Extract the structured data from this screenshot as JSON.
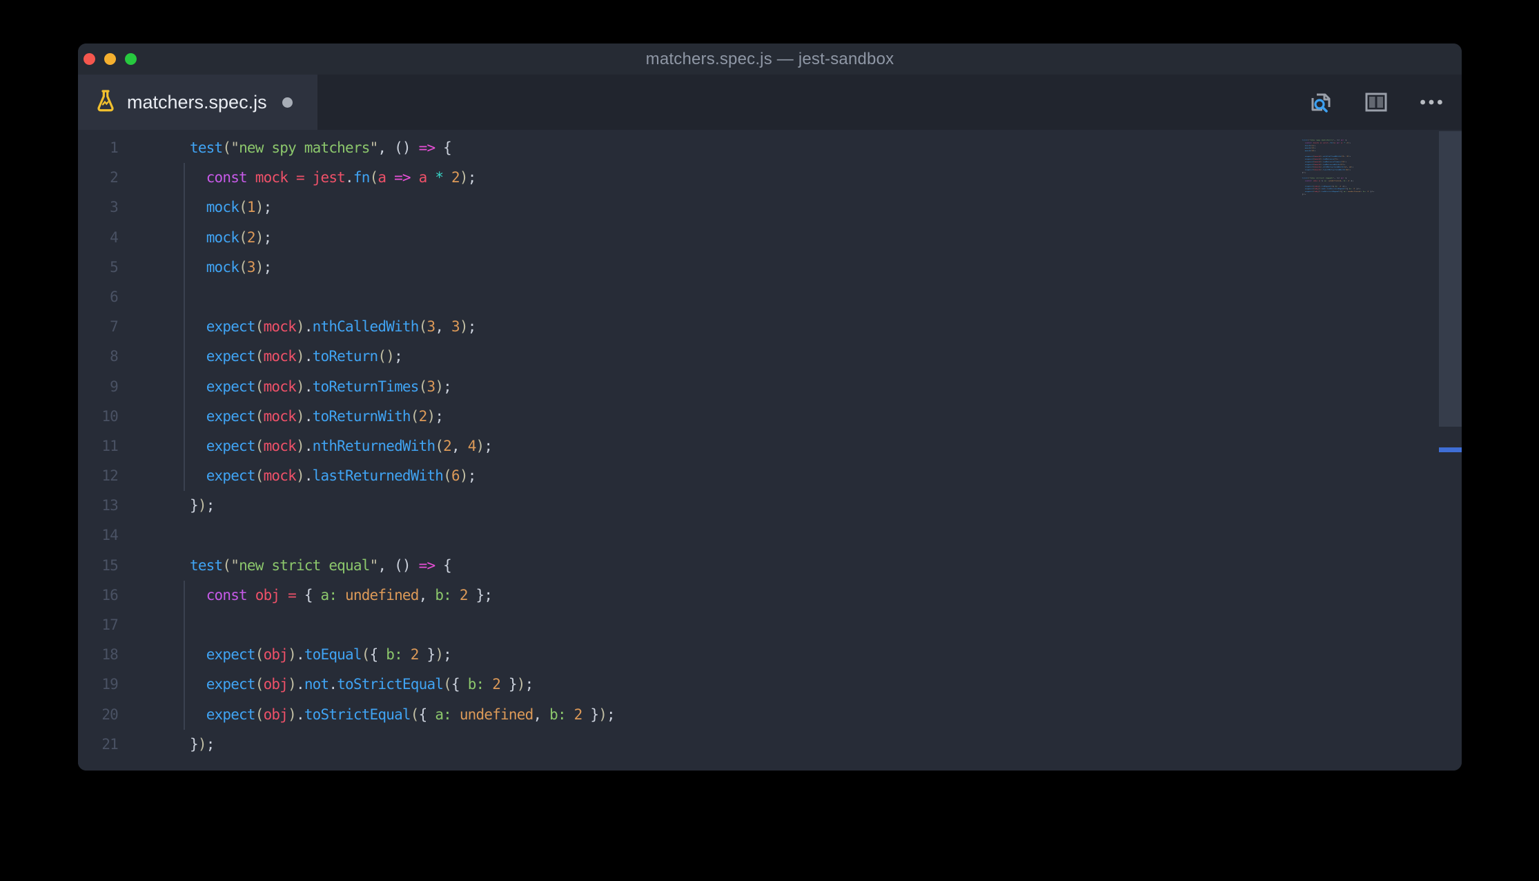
{
  "titlebar": {
    "title": "matchers.spec.js — jest-sandbox"
  },
  "traffic_lights": {
    "close": "#f5574e",
    "minimize": "#f5b02f",
    "zoom": "#27c93f"
  },
  "tab": {
    "filename": "matchers.spec.js",
    "modified": true,
    "icon": "beaker-test-icon"
  },
  "actions": {
    "search": "search-in-file-icon",
    "split": "split-editor-icon",
    "more": "more-actions-icon"
  },
  "colors": {
    "fn": "#40a4f4",
    "st": "#8cc76c",
    "kw": "#c75ae8",
    "va": "#ef5169",
    "op": "#ef5169",
    "ar": "#e84fd7",
    "nu": "#dd9a58",
    "cy": "#38d4c5",
    "pu": "#ccd2dd",
    "pa": "#c2bfa4",
    "ke": "#8cc76c",
    "ln": "#4a5264",
    "mk": "#3f6ed5",
    "editor_bg": "#272c37",
    "tabbar_bg": "#21252e",
    "tab_bg": "#2d323e",
    "titlebar_bg": "#262b34"
  },
  "code": {
    "lines": [
      {
        "num": 1,
        "guide": false,
        "tokens": [
          {
            "t": "test",
            "c": "fn"
          },
          {
            "t": "(",
            "c": "pa"
          },
          {
            "t": "\"",
            "c": "pa"
          },
          {
            "t": "new spy matchers",
            "c": "st"
          },
          {
            "t": "\"",
            "c": "pa"
          },
          {
            "t": ", ",
            "c": "pu"
          },
          {
            "t": "()",
            "c": "pu"
          },
          {
            "t": " ",
            "c": "pu"
          },
          {
            "t": "=>",
            "c": "ar"
          },
          {
            "t": " {",
            "c": "pu"
          }
        ]
      },
      {
        "num": 2,
        "guide": true,
        "tokens": [
          {
            "t": "  ",
            "c": "pu"
          },
          {
            "t": "const",
            "c": "kw"
          },
          {
            "t": " ",
            "c": "pu"
          },
          {
            "t": "mock",
            "c": "va"
          },
          {
            "t": " ",
            "c": "pu"
          },
          {
            "t": "=",
            "c": "op"
          },
          {
            "t": " ",
            "c": "pu"
          },
          {
            "t": "jest",
            "c": "va"
          },
          {
            "t": ".",
            "c": "pu"
          },
          {
            "t": "fn",
            "c": "fn"
          },
          {
            "t": "(",
            "c": "pa"
          },
          {
            "t": "a",
            "c": "va"
          },
          {
            "t": " ",
            "c": "pu"
          },
          {
            "t": "=>",
            "c": "ar"
          },
          {
            "t": " ",
            "c": "pu"
          },
          {
            "t": "a",
            "c": "va"
          },
          {
            "t": " ",
            "c": "pu"
          },
          {
            "t": "*",
            "c": "cy"
          },
          {
            "t": " ",
            "c": "pu"
          },
          {
            "t": "2",
            "c": "nu"
          },
          {
            "t": ")",
            "c": "pa"
          },
          {
            "t": ";",
            "c": "pu"
          }
        ]
      },
      {
        "num": 3,
        "guide": true,
        "tokens": [
          {
            "t": "  ",
            "c": "pu"
          },
          {
            "t": "mock",
            "c": "fn"
          },
          {
            "t": "(",
            "c": "pa"
          },
          {
            "t": "1",
            "c": "nu"
          },
          {
            "t": ")",
            "c": "pa"
          },
          {
            "t": ";",
            "c": "pu"
          }
        ]
      },
      {
        "num": 4,
        "guide": true,
        "tokens": [
          {
            "t": "  ",
            "c": "pu"
          },
          {
            "t": "mock",
            "c": "fn"
          },
          {
            "t": "(",
            "c": "pa"
          },
          {
            "t": "2",
            "c": "nu"
          },
          {
            "t": ")",
            "c": "pa"
          },
          {
            "t": ";",
            "c": "pu"
          }
        ]
      },
      {
        "num": 5,
        "guide": true,
        "tokens": [
          {
            "t": "  ",
            "c": "pu"
          },
          {
            "t": "mock",
            "c": "fn"
          },
          {
            "t": "(",
            "c": "pa"
          },
          {
            "t": "3",
            "c": "nu"
          },
          {
            "t": ")",
            "c": "pa"
          },
          {
            "t": ";",
            "c": "pu"
          }
        ]
      },
      {
        "num": 6,
        "guide": true,
        "tokens": []
      },
      {
        "num": 7,
        "guide": true,
        "tokens": [
          {
            "t": "  ",
            "c": "pu"
          },
          {
            "t": "expect",
            "c": "fn"
          },
          {
            "t": "(",
            "c": "pa"
          },
          {
            "t": "mock",
            "c": "va"
          },
          {
            "t": ")",
            "c": "pa"
          },
          {
            "t": ".",
            "c": "pu"
          },
          {
            "t": "nthCalledWith",
            "c": "fn"
          },
          {
            "t": "(",
            "c": "pa"
          },
          {
            "t": "3",
            "c": "nu"
          },
          {
            "t": ", ",
            "c": "pu"
          },
          {
            "t": "3",
            "c": "nu"
          },
          {
            "t": ")",
            "c": "pa"
          },
          {
            "t": ";",
            "c": "pu"
          }
        ]
      },
      {
        "num": 8,
        "guide": true,
        "tokens": [
          {
            "t": "  ",
            "c": "pu"
          },
          {
            "t": "expect",
            "c": "fn"
          },
          {
            "t": "(",
            "c": "pa"
          },
          {
            "t": "mock",
            "c": "va"
          },
          {
            "t": ")",
            "c": "pa"
          },
          {
            "t": ".",
            "c": "pu"
          },
          {
            "t": "toReturn",
            "c": "fn"
          },
          {
            "t": "()",
            "c": "pa"
          },
          {
            "t": ";",
            "c": "pu"
          }
        ]
      },
      {
        "num": 9,
        "guide": true,
        "tokens": [
          {
            "t": "  ",
            "c": "pu"
          },
          {
            "t": "expect",
            "c": "fn"
          },
          {
            "t": "(",
            "c": "pa"
          },
          {
            "t": "mock",
            "c": "va"
          },
          {
            "t": ")",
            "c": "pa"
          },
          {
            "t": ".",
            "c": "pu"
          },
          {
            "t": "toReturnTimes",
            "c": "fn"
          },
          {
            "t": "(",
            "c": "pa"
          },
          {
            "t": "3",
            "c": "nu"
          },
          {
            "t": ")",
            "c": "pa"
          },
          {
            "t": ";",
            "c": "pu"
          }
        ]
      },
      {
        "num": 10,
        "guide": true,
        "tokens": [
          {
            "t": "  ",
            "c": "pu"
          },
          {
            "t": "expect",
            "c": "fn"
          },
          {
            "t": "(",
            "c": "pa"
          },
          {
            "t": "mock",
            "c": "va"
          },
          {
            "t": ")",
            "c": "pa"
          },
          {
            "t": ".",
            "c": "pu"
          },
          {
            "t": "toReturnWith",
            "c": "fn"
          },
          {
            "t": "(",
            "c": "pa"
          },
          {
            "t": "2",
            "c": "nu"
          },
          {
            "t": ")",
            "c": "pa"
          },
          {
            "t": ";",
            "c": "pu"
          }
        ]
      },
      {
        "num": 11,
        "guide": true,
        "tokens": [
          {
            "t": "  ",
            "c": "pu"
          },
          {
            "t": "expect",
            "c": "fn"
          },
          {
            "t": "(",
            "c": "pa"
          },
          {
            "t": "mock",
            "c": "va"
          },
          {
            "t": ")",
            "c": "pa"
          },
          {
            "t": ".",
            "c": "pu"
          },
          {
            "t": "nthReturnedWith",
            "c": "fn"
          },
          {
            "t": "(",
            "c": "pa"
          },
          {
            "t": "2",
            "c": "nu"
          },
          {
            "t": ", ",
            "c": "pu"
          },
          {
            "t": "4",
            "c": "nu"
          },
          {
            "t": ")",
            "c": "pa"
          },
          {
            "t": ";",
            "c": "pu"
          }
        ]
      },
      {
        "num": 12,
        "guide": true,
        "tokens": [
          {
            "t": "  ",
            "c": "pu"
          },
          {
            "t": "expect",
            "c": "fn"
          },
          {
            "t": "(",
            "c": "pa"
          },
          {
            "t": "mock",
            "c": "va"
          },
          {
            "t": ")",
            "c": "pa"
          },
          {
            "t": ".",
            "c": "pu"
          },
          {
            "t": "lastReturnedWith",
            "c": "fn"
          },
          {
            "t": "(",
            "c": "pa"
          },
          {
            "t": "6",
            "c": "nu"
          },
          {
            "t": ")",
            "c": "pa"
          },
          {
            "t": ";",
            "c": "pu"
          }
        ]
      },
      {
        "num": 13,
        "guide": false,
        "tokens": [
          {
            "t": "}",
            "c": "pu"
          },
          {
            "t": ")",
            "c": "pa"
          },
          {
            "t": ";",
            "c": "pu"
          }
        ]
      },
      {
        "num": 14,
        "guide": false,
        "tokens": []
      },
      {
        "num": 15,
        "guide": false,
        "tokens": [
          {
            "t": "test",
            "c": "fn"
          },
          {
            "t": "(",
            "c": "pa"
          },
          {
            "t": "\"",
            "c": "pa"
          },
          {
            "t": "new strict equal",
            "c": "st"
          },
          {
            "t": "\"",
            "c": "pa"
          },
          {
            "t": ", ",
            "c": "pu"
          },
          {
            "t": "()",
            "c": "pu"
          },
          {
            "t": " ",
            "c": "pu"
          },
          {
            "t": "=>",
            "c": "ar"
          },
          {
            "t": " {",
            "c": "pu"
          }
        ]
      },
      {
        "num": 16,
        "guide": true,
        "tokens": [
          {
            "t": "  ",
            "c": "pu"
          },
          {
            "t": "const",
            "c": "kw"
          },
          {
            "t": " ",
            "c": "pu"
          },
          {
            "t": "obj",
            "c": "va"
          },
          {
            "t": " ",
            "c": "pu"
          },
          {
            "t": "=",
            "c": "op"
          },
          {
            "t": " ",
            "c": "pu"
          },
          {
            "t": "{ ",
            "c": "pu"
          },
          {
            "t": "a:",
            "c": "ke"
          },
          {
            "t": " ",
            "c": "pu"
          },
          {
            "t": "undefined",
            "c": "nu"
          },
          {
            "t": ", ",
            "c": "pu"
          },
          {
            "t": "b:",
            "c": "ke"
          },
          {
            "t": " ",
            "c": "pu"
          },
          {
            "t": "2",
            "c": "nu"
          },
          {
            "t": " }",
            "c": "pu"
          },
          {
            "t": ";",
            "c": "pu"
          }
        ]
      },
      {
        "num": 17,
        "guide": true,
        "tokens": []
      },
      {
        "num": 18,
        "guide": true,
        "tokens": [
          {
            "t": "  ",
            "c": "pu"
          },
          {
            "t": "expect",
            "c": "fn"
          },
          {
            "t": "(",
            "c": "pa"
          },
          {
            "t": "obj",
            "c": "va"
          },
          {
            "t": ")",
            "c": "pa"
          },
          {
            "t": ".",
            "c": "pu"
          },
          {
            "t": "toEqual",
            "c": "fn"
          },
          {
            "t": "(",
            "c": "pa"
          },
          {
            "t": "{ ",
            "c": "pu"
          },
          {
            "t": "b:",
            "c": "ke"
          },
          {
            "t": " ",
            "c": "pu"
          },
          {
            "t": "2",
            "c": "nu"
          },
          {
            "t": " }",
            "c": "pu"
          },
          {
            "t": ")",
            "c": "pa"
          },
          {
            "t": ";",
            "c": "pu"
          }
        ]
      },
      {
        "num": 19,
        "guide": true,
        "tokens": [
          {
            "t": "  ",
            "c": "pu"
          },
          {
            "t": "expect",
            "c": "fn"
          },
          {
            "t": "(",
            "c": "pa"
          },
          {
            "t": "obj",
            "c": "va"
          },
          {
            "t": ")",
            "c": "pa"
          },
          {
            "t": ".",
            "c": "pu"
          },
          {
            "t": "not",
            "c": "fn"
          },
          {
            "t": ".",
            "c": "pu"
          },
          {
            "t": "toStrictEqual",
            "c": "fn"
          },
          {
            "t": "(",
            "c": "pa"
          },
          {
            "t": "{ ",
            "c": "pu"
          },
          {
            "t": "b:",
            "c": "ke"
          },
          {
            "t": " ",
            "c": "pu"
          },
          {
            "t": "2",
            "c": "nu"
          },
          {
            "t": " }",
            "c": "pu"
          },
          {
            "t": ")",
            "c": "pa"
          },
          {
            "t": ";",
            "c": "pu"
          }
        ]
      },
      {
        "num": 20,
        "guide": true,
        "tokens": [
          {
            "t": "  ",
            "c": "pu"
          },
          {
            "t": "expect",
            "c": "fn"
          },
          {
            "t": "(",
            "c": "pa"
          },
          {
            "t": "obj",
            "c": "va"
          },
          {
            "t": ")",
            "c": "pa"
          },
          {
            "t": ".",
            "c": "pu"
          },
          {
            "t": "toStrictEqual",
            "c": "fn"
          },
          {
            "t": "(",
            "c": "pa"
          },
          {
            "t": "{ ",
            "c": "pu"
          },
          {
            "t": "a:",
            "c": "ke"
          },
          {
            "t": " ",
            "c": "pu"
          },
          {
            "t": "undefined",
            "c": "nu"
          },
          {
            "t": ", ",
            "c": "pu"
          },
          {
            "t": "b:",
            "c": "ke"
          },
          {
            "t": " ",
            "c": "pu"
          },
          {
            "t": "2",
            "c": "nu"
          },
          {
            "t": " }",
            "c": "pu"
          },
          {
            "t": ")",
            "c": "pa"
          },
          {
            "t": ";",
            "c": "pu"
          }
        ]
      },
      {
        "num": 21,
        "guide": false,
        "tokens": [
          {
            "t": "}",
            "c": "pu"
          },
          {
            "t": ")",
            "c": "pa"
          },
          {
            "t": ";",
            "c": "pu"
          }
        ]
      }
    ]
  }
}
